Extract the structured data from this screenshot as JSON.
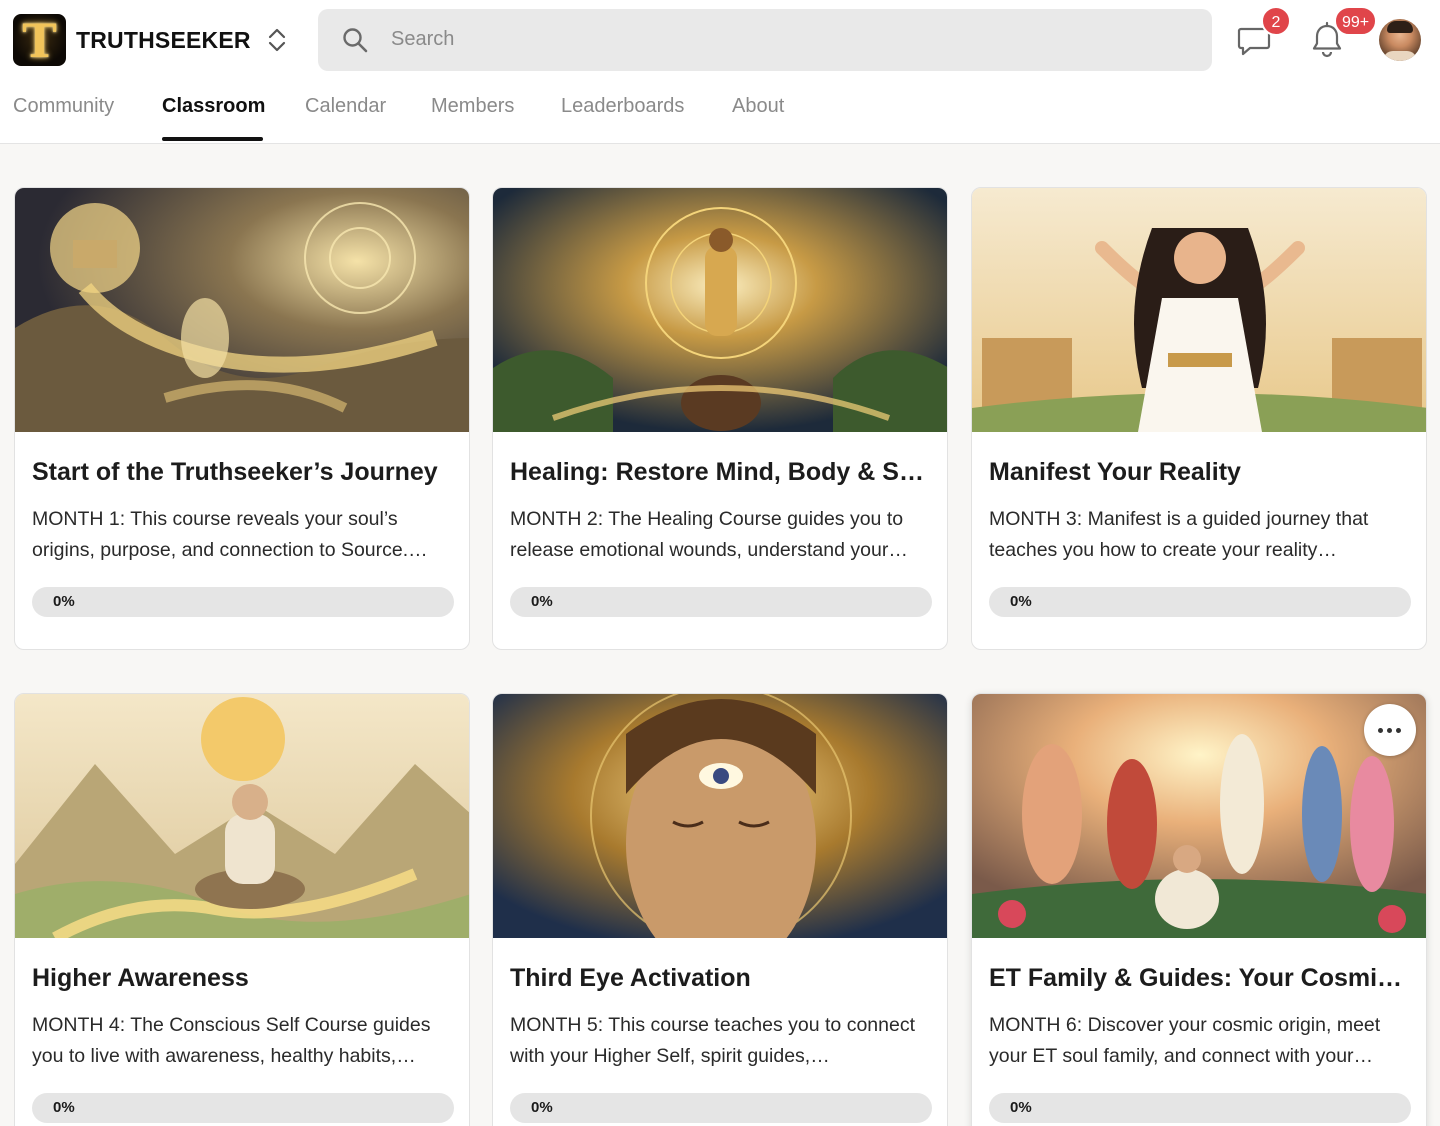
{
  "header": {
    "brand": "TRUTHSEEKER",
    "logo_letter": "T",
    "search_placeholder": "Search",
    "chat_badge": "2",
    "notif_badge": "99+",
    "accent_badge_color": "#e0454a"
  },
  "tabs": [
    {
      "label": "Community",
      "active": false
    },
    {
      "label": "Classroom",
      "active": true
    },
    {
      "label": "Calendar",
      "active": false
    },
    {
      "label": "Members",
      "active": false
    },
    {
      "label": "Leaderboards",
      "active": false
    },
    {
      "label": "About",
      "active": false
    }
  ],
  "courses": [
    {
      "title": "Start of the Truthseeker’s Journey",
      "description": "MONTH 1: This course reveals your soul’s origins, purpose, and connection to Source.…",
      "progress_label": "0%",
      "progress": 0
    },
    {
      "title": "Healing: Restore Mind, Body & Soul",
      "description": "MONTH 2: The Healing Course guides you to release emotional wounds, understand your…",
      "progress_label": "0%",
      "progress": 0
    },
    {
      "title": "Manifest Your Reality",
      "description": "MONTH 3: Manifest is a guided journey that teaches you how to create your reality…",
      "progress_label": "0%",
      "progress": 0
    },
    {
      "title": "Higher Awareness",
      "description": "MONTH 4: The Conscious Self Course guides you to live with awareness, healthy habits,…",
      "progress_label": "0%",
      "progress": 0
    },
    {
      "title": "Third Eye Activation",
      "description": "MONTH 5: This course teaches you to connect with your Higher Self, spirit guides,…",
      "progress_label": "0%",
      "progress": 0
    },
    {
      "title": "ET Family & Guides: Your Cosmic …",
      "description": "MONTH 6: Discover your cosmic origin, meet your ET soul family, and connect with your…",
      "progress_label": "0%",
      "progress": 0
    }
  ]
}
